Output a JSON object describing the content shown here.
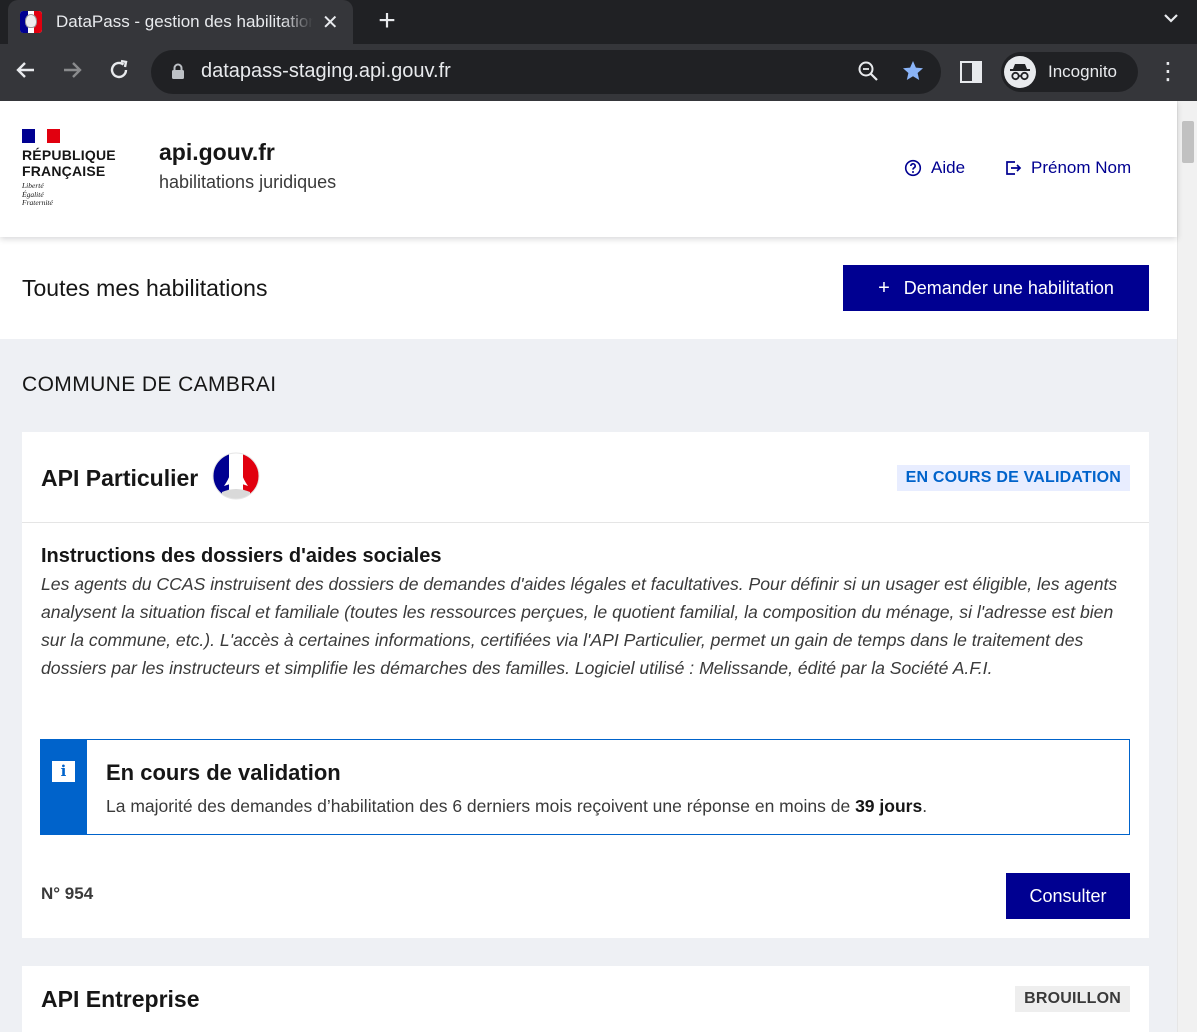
{
  "browser": {
    "tab_title": "DataPass - gestion des habilitations",
    "url": "datapass-staging.api.gouv.fr",
    "profile_label": "Incognito",
    "accent_star": "#8ab4f8"
  },
  "header": {
    "brand_line1": "RÉPUBLIQUE",
    "brand_line2": "FRANÇAISE",
    "motto_1": "Liberté",
    "motto_2": "Égalité",
    "motto_3": "Fraternité",
    "service_title": "api.gouv.fr",
    "service_tagline": "habilitations juridiques",
    "help_label": "Aide",
    "user_label": "Prénom Nom"
  },
  "page": {
    "title": "Toutes mes habilitations",
    "request_button": "Demander une habilitation"
  },
  "organization": {
    "name": "COMMUNE DE CAMBRAI"
  },
  "cards": [
    {
      "name": "API Particulier",
      "status": "EN COURS DE VALIDATION",
      "subtitle": "Instructions des dossiers d'aides sociales",
      "description": "Les agents du CCAS instruisent des dossiers de demandes d'aides légales et facultatives. Pour définir si un usager est éligible, les agents analysent la situation fiscal et familiale (toutes les ressources perçues, le quotient familial, la composition du ménage, si l'adresse est bien sur la commune, etc.). L'accès à certaines informations, certifiées via l'API Particulier, permet un gain de temps dans le traitement des dossiers par les instructeurs et simplifie les démarches des familles. Logiciel utilisé : Melissande, édité par la Société A.F.I.",
      "callout_title": "En cours de validation",
      "callout_text_before": "La majorité des demandes d’habilitation des 6 derniers mois reçoivent une réponse en moins de ",
      "callout_text_bold": "39 jours",
      "callout_text_after": ".",
      "number": "N° 954",
      "action_label": "Consulter"
    },
    {
      "name": "API Entreprise",
      "status": "BROUILLON"
    }
  ],
  "colors": {
    "primary": "#000091",
    "info": "#0063cb",
    "marianne_red": "#e1000f",
    "page_bg": "#eef0f4"
  }
}
